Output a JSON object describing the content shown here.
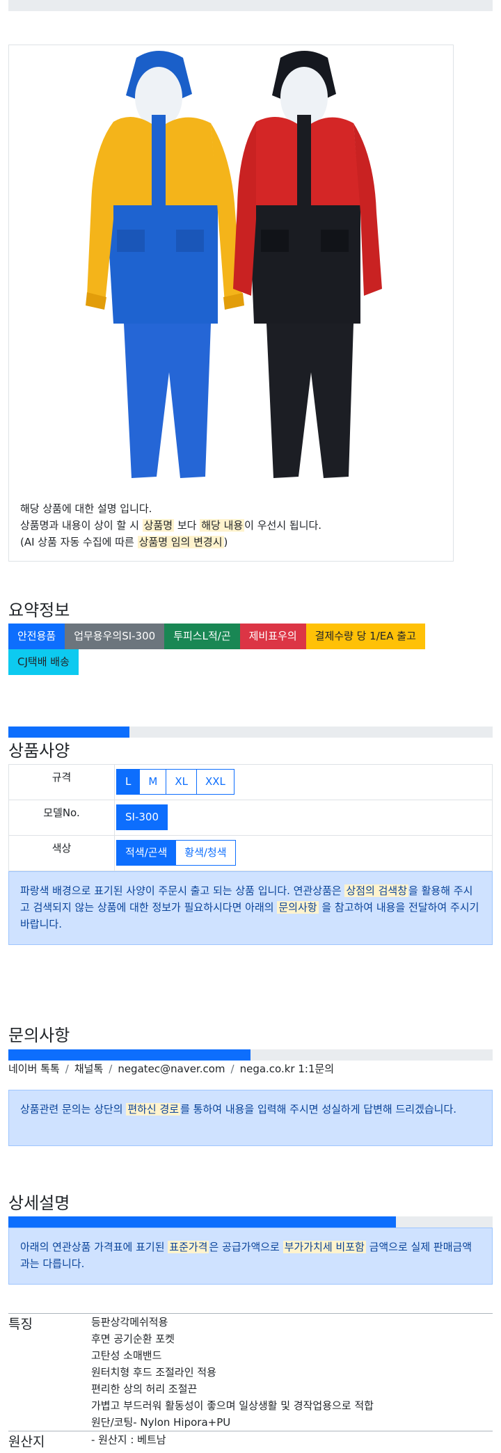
{
  "product_card": {
    "desc_line1": "해당 상품에 대한 설명 입니다.",
    "desc_line2": {
      "a": "상품명과 내용이 상이 할 시 ",
      "m1": "상품명",
      "b": " 보다 ",
      "m2": "해당 내용",
      "c": "이 우선시 됩니다."
    },
    "desc_line3": {
      "a": "(AI 상품 자동 수집에 따른 ",
      "m1": "상품명 임의 변경시",
      "b": ")"
    }
  },
  "summary": {
    "title": "요약정보",
    "badges": [
      "안전용품",
      "업무용우의SI-300",
      "투피스L적/곤",
      "제비표우의",
      "결제수량 당 1/EA 출고",
      "CJ택배 배송"
    ]
  },
  "spec": {
    "title": "상품사양",
    "progress_fraction": 0.25,
    "rows": [
      {
        "label": "규격",
        "options": [
          "L",
          "M",
          "XL",
          "XXL"
        ],
        "selected": "L"
      },
      {
        "label": "모델No.",
        "options": [
          "SI-300"
        ],
        "selected": "SI-300"
      },
      {
        "label": "색상",
        "options": [
          "적색/곤색",
          "황색/청색"
        ],
        "selected": "적색/곤색"
      }
    ],
    "notice": {
      "a": "파랑색 배경으로 표기된 사양이 주문시 출고 되는 상품 입니다. 연관상품은 ",
      "m1": "상점의 검색창",
      "b": "을 활용해 주시고 검색되지 않는 상품에 대한 정보가 필요하시다면 아래의 ",
      "m2": "문의사항",
      "c": " 을 참고하여 내용을 전달하여 주시기 바랍니다."
    }
  },
  "inquiry": {
    "title": "문의사항",
    "progress_fraction": 0.5,
    "channels": [
      "네이버 톡톡",
      "채널톡",
      "negatec@naver.com",
      "nega.co.kr 1:1문의"
    ],
    "notice": {
      "a": "상품관련 문의는 상단의 ",
      "m1": "편하신 경로",
      "b": "를 통하여 내용을 입력해 주시면 성실하게 답변해 드리겠습니다."
    }
  },
  "detail": {
    "title": "상세설명",
    "progress_fraction": 0.8,
    "notice": {
      "a": "아래의 연관상품 가격표에 표기된 ",
      "m1": "표준가격",
      "b": "은 공급가액으로 ",
      "m2": "부가가치세 비포함",
      "c": " 금액으로 실제 판매금액과는 다릅니다."
    },
    "features_label": "특징",
    "features": [
      "등판상각메쉬적용",
      "후면 공기순환 포켓",
      "고탄성 소매밴드",
      "원터치형 후드 조절라인 적용",
      "편리한 상의 허리 조절끈",
      "가볍고 부드러워 활동성이 좋으며 일상생활 및 경작업용으로 적합",
      "원단/코팅- Nylon Hipora+PU"
    ],
    "origin_label": "원산지",
    "origin": "- 원산지 : 베트남"
  },
  "colors": {
    "primary": "#0d6efd",
    "secondary": "#6c757d",
    "success": "#198754",
    "danger": "#dc3545",
    "warning": "#ffc107",
    "info": "#0dcaf0",
    "mark": "#fff3cd",
    "alert_bg": "#cfe2ff"
  }
}
